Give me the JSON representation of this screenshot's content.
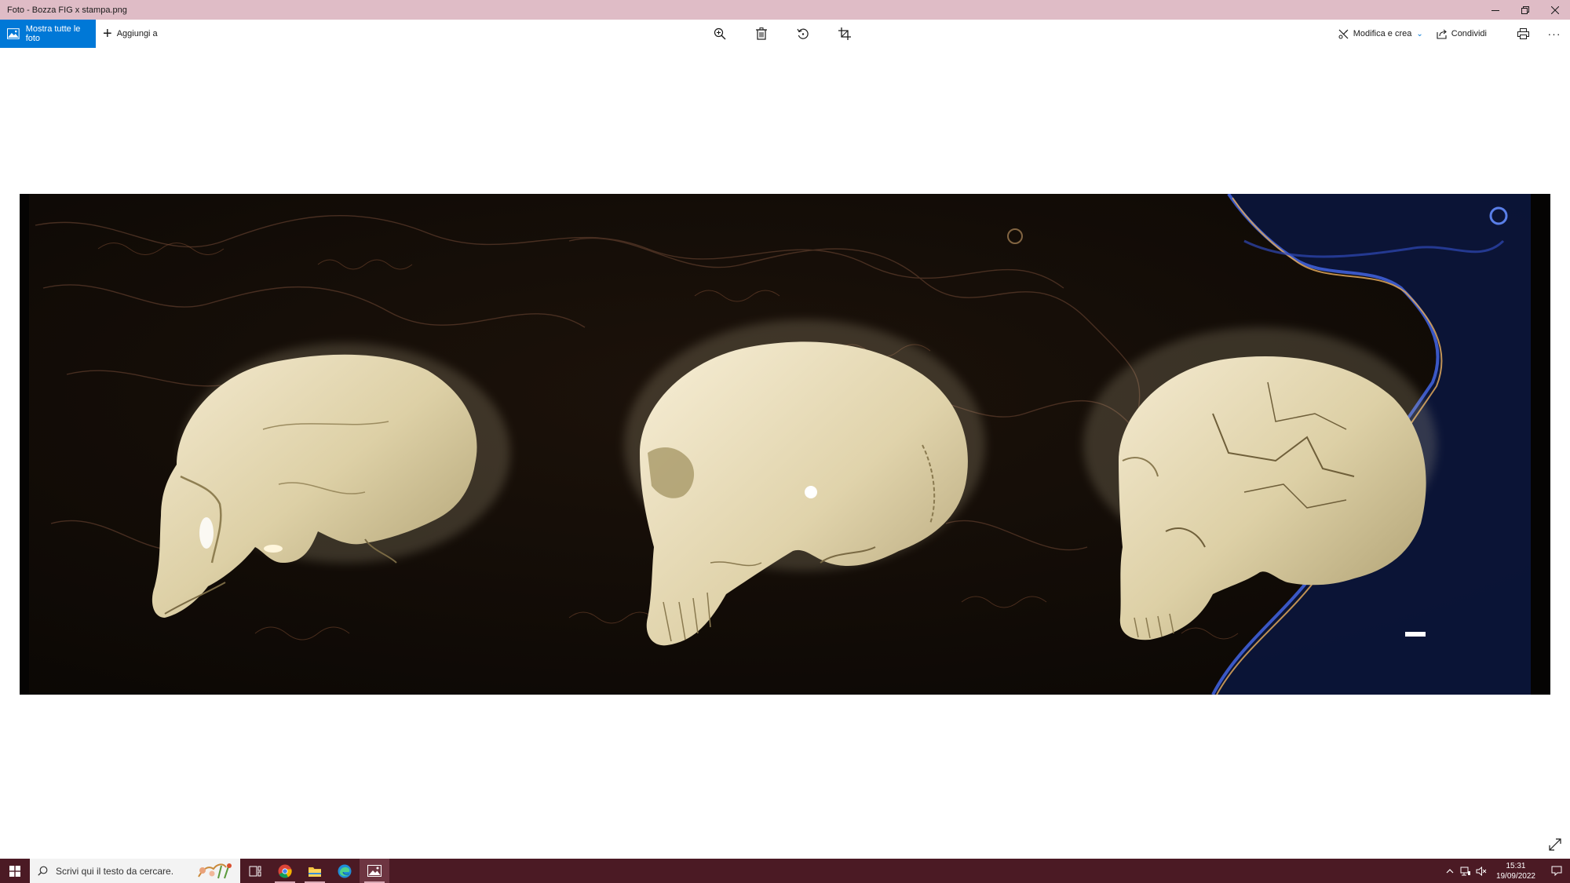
{
  "window": {
    "title": "Foto - Bozza FIG x stampa.png",
    "controls": [
      "minimize-icon",
      "restore-icon",
      "close-icon"
    ]
  },
  "toolbar": {
    "show_all_label": "Mostra tutte le foto",
    "add_to_label": "Aggiungi a",
    "center_tools": [
      "zoom-in-icon",
      "delete-icon",
      "rotate-icon",
      "crop-icon"
    ],
    "edit_create_label": "Modifica e crea",
    "share_label": "Condividi",
    "print_icon": "print-icon",
    "more_icon": "more-icon"
  },
  "photo": {
    "subject": "three skulls in profile",
    "background": "dark textured map",
    "accent_colors": [
      "#e8dcb4",
      "#2a3fa8",
      "#c9834b"
    ]
  },
  "taskbar": {
    "search_placeholder": "Scrivi qui il testo da cercare.",
    "apps": [
      "task-view-icon",
      "chrome-icon",
      "file-explorer-icon",
      "edge-icon",
      "photos-icon"
    ],
    "active_app": "photos-icon",
    "time": "15:31",
    "date": "19/09/2022",
    "background": "#4b1a24"
  }
}
